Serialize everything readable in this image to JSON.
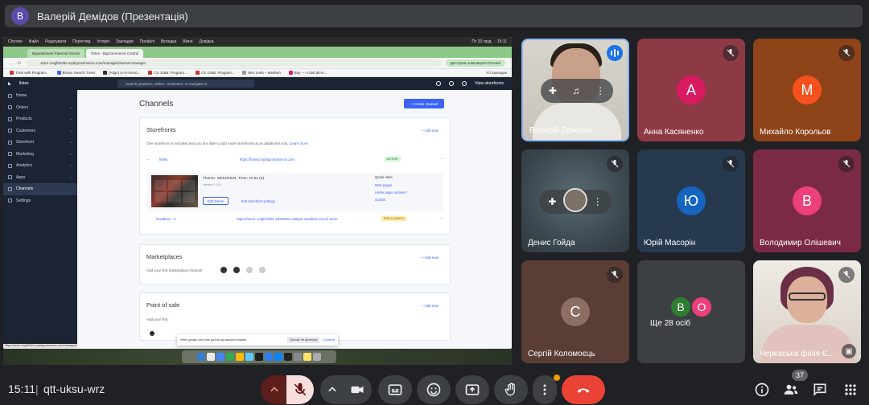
{
  "presenter": {
    "initial": "В",
    "title": "Валерій Демідов (Презентація)"
  },
  "shared_screen": {
    "mac_menu": [
      "Chrome",
      "Файл",
      "Редагувати",
      "Перегляд",
      "Історія",
      "Закладки",
      "Профілі",
      "Вкладка",
      "Вікно",
      "Довідка"
    ],
    "mac_time": "15:11",
    "mac_date": "Пт 20 груд.",
    "tabs": [
      "Відновлення Paternal Stocks",
      "fintex - BigCommerce Control"
    ],
    "address": "store-1xqjf3100s.mybigcommerce.com/manage/channel-manager",
    "update_pill": "Доступна нова версія Chrome",
    "bookmarks": [
      "Train with Program...",
      "Binary Search Trees",
      "[Align] cs-b-rmmd...",
      "CS 106B: Program...",
      "CS 106B: Program...",
      "Ben Leeb – Medium",
      "Buy — A fast alt-in..."
    ],
    "bookmarks_right": "Усі закладки",
    "brand": "fintex",
    "sidebar": [
      {
        "label": "Home",
        "chev": false
      },
      {
        "label": "Orders",
        "chev": true
      },
      {
        "label": "Products",
        "chev": true
      },
      {
        "label": "Customers",
        "chev": true
      },
      {
        "label": "Storefront",
        "chev": true
      },
      {
        "label": "Marketing",
        "chev": true
      },
      {
        "label": "Analytics",
        "chev": true
      },
      {
        "label": "Apps",
        "chev": true
      },
      {
        "label": "Channels",
        "chev": false
      },
      {
        "label": "Settings",
        "chev": false
      }
    ],
    "search_placeholder": "Search products, orders, customers, or navigate to",
    "view_storefronts": "View storefronts",
    "page_title": "Channels",
    "create_channel": "+ Create channel",
    "storefronts_title": "Storefronts",
    "add_new": "+ Add new",
    "storefronts_info": "One storefront is included and you are able to add more storefronts at an additional cost.",
    "learn_more": "Learn more",
    "sf1": {
      "name": "fintex",
      "url": "https://fintex.mybigcommerce.com",
      "badge": "ACTIVE"
    },
    "theme": {
      "title": "Theme: 16/12/2024, Time: 11:03 (2)",
      "version": "Version 1.1.0",
      "edit_theme": "Edit theme",
      "edit_settings": "Edit storefront settings"
    },
    "quick_links": {
      "title": "Quick links",
      "items": [
        "Web pages",
        "Home page carousel",
        "Scripts"
      ]
    },
    "sf2": {
      "name": "headless · 2",
      "url": "https://store-1xqjf3100s-1690949.catalyst-sandbox-vercel.store",
      "badge": "PRE-LAUNCH"
    },
    "marketplaces_title": "Marketplaces",
    "marketplaces_info": "Add your first marketplace channel",
    "pos_title": "Point of sale",
    "pos_info": "Add your first",
    "status_url": "https://store-1xqjf3100s.mybigcommerce.com/manage/channel-manager",
    "toast": {
      "text": "meet.google.com має доступ до вашого екрана",
      "stop": "Більше не ділитися",
      "hide": "Сховати"
    }
  },
  "tiles": [
    {
      "name": "Валерій Демідов",
      "type": "video"
    },
    {
      "name": "Анна Касяненко",
      "initial": "А",
      "bg": "#8e3a45",
      "av": "#d81b60"
    },
    {
      "name": "Михайло Корольов",
      "initial": "М",
      "bg": "#8e4318",
      "av": "#f4511e"
    },
    {
      "name": "Денис Гойда",
      "type": "video2"
    },
    {
      "name": "Юрій Масорін",
      "initial": "Ю",
      "bg": "#27394f",
      "av": "#1565c0"
    },
    {
      "name": "Володимир Олішевич",
      "initial": "В",
      "bg": "#7b2a45",
      "av": "#ec407a"
    },
    {
      "name": "Сергій Коломоєць",
      "initial": "С",
      "bg": "#5a3d34",
      "av": "#8d6e63"
    },
    {
      "name": "Ще 28 осіб",
      "type": "others",
      "a": "В",
      "b": "О"
    },
    {
      "name": "Черкаська філія Є...",
      "type": "video3"
    }
  ],
  "bottom": {
    "time": "15:11",
    "separator": "|",
    "meeting_code": "qtt-uksu-wrz",
    "participants_count": "37"
  }
}
